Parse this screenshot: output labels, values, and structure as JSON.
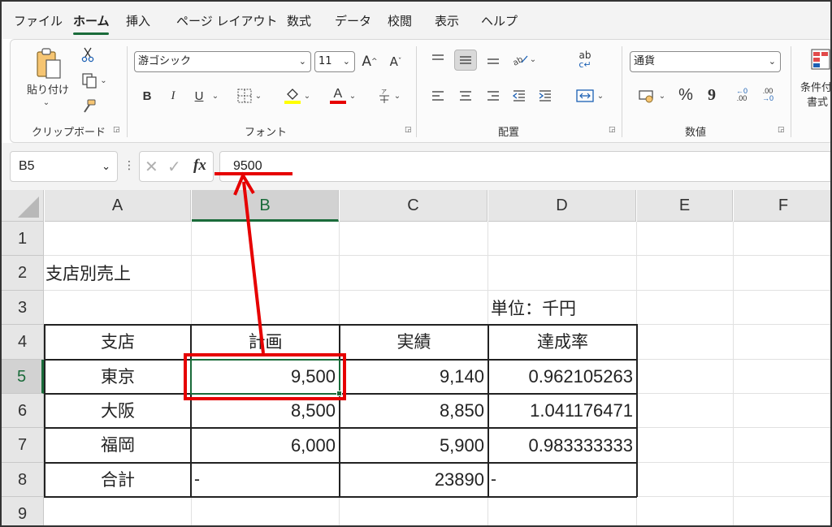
{
  "menu": {
    "items": [
      "ファイル",
      "ホーム",
      "挿入",
      "ページ レイアウト",
      "数式",
      "データ",
      "校閲",
      "表示",
      "ヘルプ"
    ],
    "active_index": 1
  },
  "ribbon": {
    "clipboard": {
      "paste_label": "貼り付け",
      "group_label": "クリップボード"
    },
    "font": {
      "font_name": "游ゴシック",
      "font_size": "11",
      "grow_label": "A",
      "shrink_label": "A",
      "bold_label": "B",
      "italic_label": "I",
      "underline_label": "U",
      "font_color_label": "A",
      "group_label": "フォント"
    },
    "alignment": {
      "group_label": "配置"
    },
    "number": {
      "format": "通貨",
      "percent_label": "%",
      "comma_label": "9",
      "group_label": "数値"
    },
    "styles": {
      "conditional_label_1": "条件付",
      "conditional_label_2": "書式"
    }
  },
  "formula_bar": {
    "name_box": "B5",
    "fx_label": "fx",
    "value": "9500"
  },
  "sheet": {
    "columns": [
      "A",
      "B",
      "C",
      "D",
      "E",
      "F"
    ],
    "rows": [
      "1",
      "2",
      "3",
      "4",
      "5",
      "6",
      "7",
      "8",
      "9"
    ],
    "selected_column": "B",
    "selected_row": "5",
    "cells": {
      "A2": "支店別売上",
      "D3": "単位：千円",
      "A4": "支店",
      "B4": "計画",
      "C4": "実績",
      "D4": "達成率",
      "A5": "東京",
      "B5": "9,500",
      "C5": "9,140",
      "D5": "0.962105263",
      "A6": "大阪",
      "B6": "8,500",
      "C6": "8,850",
      "D6": "1.041176471",
      "A7": "福岡",
      "B7": "6,000",
      "C7": "5,900",
      "D7": "0.983333333",
      "A8": "合計",
      "B8": "-",
      "C8": "23890",
      "D8": "-"
    }
  },
  "colors": {
    "accent_green": "#1a6b3a",
    "annotation_red": "#e60000"
  }
}
